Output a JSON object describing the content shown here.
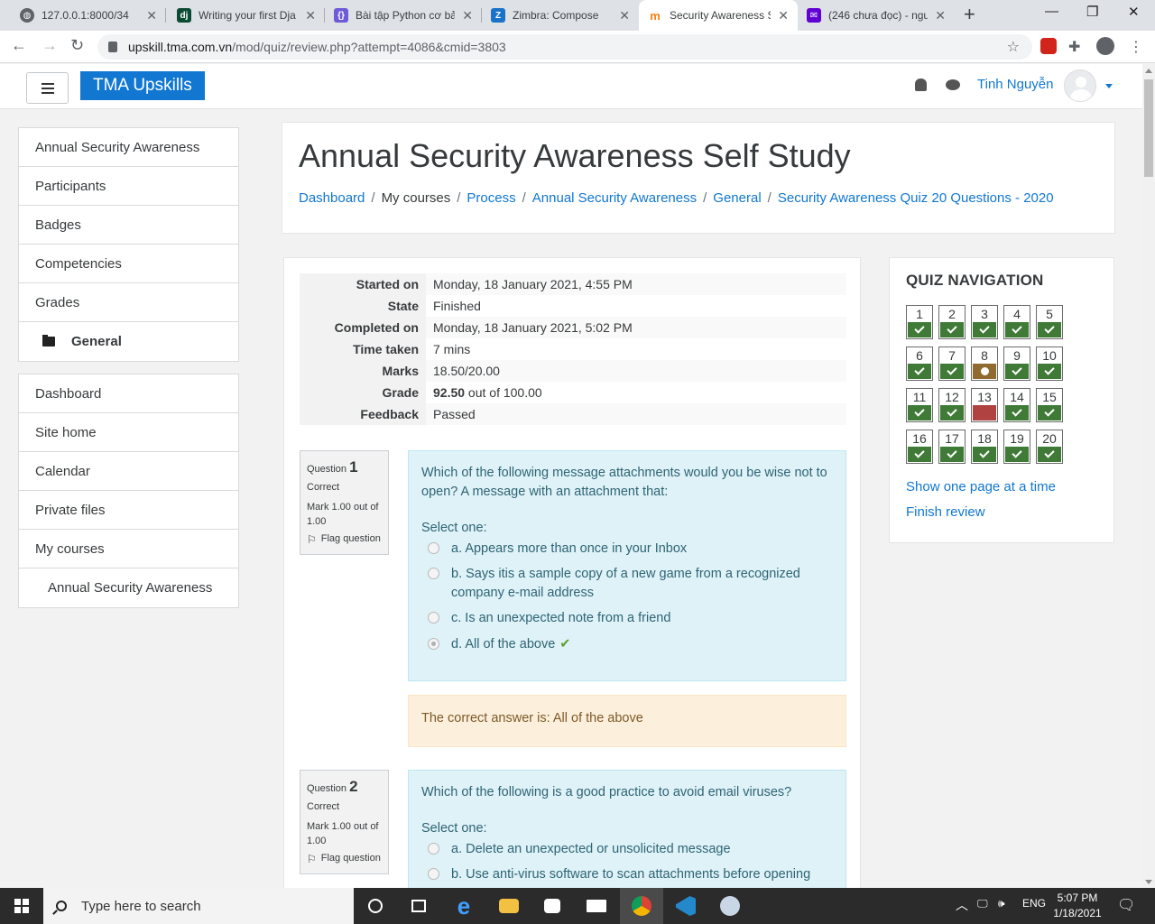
{
  "browser": {
    "tabs": [
      {
        "title": "127.0.0.1:8000/34",
        "icon": "globe-icon",
        "active": false
      },
      {
        "title": "Writing your first Dja",
        "icon": "django-icon",
        "active": false
      },
      {
        "title": "Bài tập Python cơ bả",
        "icon": "code-icon",
        "active": false
      },
      {
        "title": "Zimbra: Compose",
        "icon": "zimbra-icon",
        "active": false
      },
      {
        "title": "Security Awareness S",
        "icon": "moodle-icon",
        "active": true
      },
      {
        "title": "(246 chưa đọc) - ngu",
        "icon": "mail-icon",
        "active": false
      }
    ],
    "url_host": "upskill.tma.com.vn",
    "url_path": "/mod/quiz/review.php?attempt=4086&cmid=3803"
  },
  "header": {
    "brand": "TMA Upskills",
    "user_name": "Tinh Nguyễn"
  },
  "drawer": {
    "course_items": [
      "Annual Security Awareness",
      "Participants",
      "Badges",
      "Competencies",
      "Grades"
    ],
    "section_item": "General",
    "site_items": [
      "Dashboard",
      "Site home",
      "Calendar",
      "Private files",
      "My courses"
    ],
    "course_link": "Annual Security Awareness"
  },
  "page": {
    "title": "Annual Security Awareness Self Study",
    "breadcrumbs": [
      "Dashboard",
      "My courses",
      "Process",
      "Annual Security Awareness",
      "General",
      "Security Awareness Quiz 20 Questions - 2020"
    ]
  },
  "summary": [
    {
      "label": "Started on",
      "value": "Monday, 18 January 2021, 4:55 PM"
    },
    {
      "label": "State",
      "value": "Finished"
    },
    {
      "label": "Completed on",
      "value": "Monday, 18 January 2021, 5:02 PM"
    },
    {
      "label": "Time taken",
      "value": "7 mins"
    },
    {
      "label": "Marks",
      "value": "18.50/20.00"
    },
    {
      "label": "Grade",
      "value_bold": "92.50",
      "value_rest": " out of 100.00"
    },
    {
      "label": "Feedback",
      "value": "Passed"
    }
  ],
  "questions": [
    {
      "label": "Question",
      "number": "1",
      "state": "Correct",
      "mark": "Mark 1.00 out of 1.00",
      "flag": "Flag question",
      "text": "Which of the following message attachments would you be wise not to open? A message with an attachment that:",
      "prompt": "Select one:",
      "options": [
        "a. Appears more than once in your Inbox",
        "b. Says itis a sample copy of a new game from a recognized company e-mail address",
        "c. Is an unexpected note from a friend",
        "d. All of the above"
      ],
      "selected_index": 3,
      "feedback": "The correct answer is: All of the above"
    },
    {
      "label": "Question",
      "number": "2",
      "state": "Correct",
      "mark": "Mark 1.00 out of 1.00",
      "flag": "Flag question",
      "text": "Which of the following is a good practice to avoid email viruses?",
      "prompt": "Select one:",
      "options": [
        "a. Delete an unexpected or unsolicited message",
        "b. Use anti-virus software to scan attachments before opening"
      ]
    }
  ],
  "quiz_nav": {
    "title": "QUIZ NAVIGATION",
    "buttons": [
      {
        "n": "1",
        "state": "correct"
      },
      {
        "n": "2",
        "state": "correct"
      },
      {
        "n": "3",
        "state": "correct"
      },
      {
        "n": "4",
        "state": "correct"
      },
      {
        "n": "5",
        "state": "correct"
      },
      {
        "n": "6",
        "state": "correct"
      },
      {
        "n": "7",
        "state": "correct"
      },
      {
        "n": "8",
        "state": "partial"
      },
      {
        "n": "9",
        "state": "correct"
      },
      {
        "n": "10",
        "state": "correct"
      },
      {
        "n": "11",
        "state": "correct"
      },
      {
        "n": "12",
        "state": "correct"
      },
      {
        "n": "13",
        "state": "incorrect"
      },
      {
        "n": "14",
        "state": "correct"
      },
      {
        "n": "15",
        "state": "correct"
      },
      {
        "n": "16",
        "state": "correct"
      },
      {
        "n": "17",
        "state": "correct"
      },
      {
        "n": "18",
        "state": "correct"
      },
      {
        "n": "19",
        "state": "correct"
      },
      {
        "n": "20",
        "state": "correct"
      }
    ],
    "show_one_page": "Show one page at a time",
    "finish_review": "Finish review"
  },
  "taskbar": {
    "search_placeholder": "Type here to search",
    "language": "ENG",
    "time": "5:07 PM",
    "date": "1/18/2021"
  },
  "colors": {
    "brand": "#1177d1",
    "correct": "#3f7a37",
    "partial": "#8f6b2f",
    "incorrect": "#b04341",
    "question_bg": "#def2f8",
    "feedback_bg": "#fcefdc"
  }
}
